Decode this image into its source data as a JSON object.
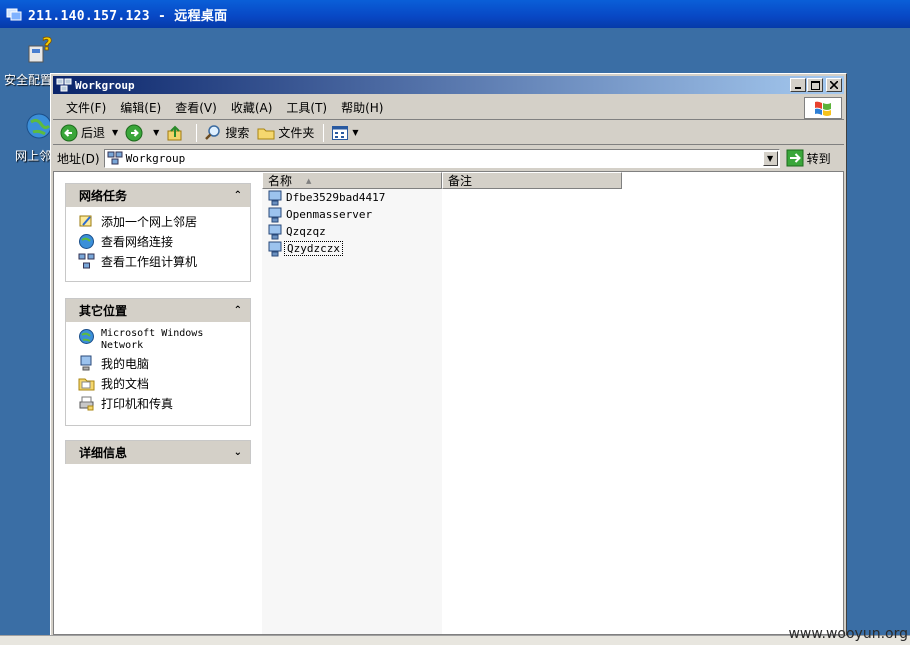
{
  "remote_titlebar": {
    "title": "211.140.157.123 - 远程桌面"
  },
  "desktop": {
    "icons": [
      {
        "label": "安全配置向导",
        "icon": "security-wizard-icon"
      },
      {
        "label": "网上邻居",
        "icon": "network-globe-icon"
      }
    ]
  },
  "window": {
    "title": "Workgroup",
    "menu": [
      "文件(F)",
      "编辑(E)",
      "查看(V)",
      "收藏(A)",
      "工具(T)",
      "帮助(H)"
    ],
    "toolbar": {
      "back": "后退",
      "search": "搜索",
      "folders": "文件夹"
    },
    "address": {
      "label": "地址(D)",
      "value": "Workgroup",
      "go": "转到"
    },
    "taskpane": {
      "network_tasks": {
        "title": "网络任务",
        "items": [
          "添加一个网上邻居",
          "查看网络连接",
          "查看工作组计算机"
        ]
      },
      "other_places": {
        "title": "其它位置",
        "items": [
          "Microsoft Windows Network",
          "我的电脑",
          "我的文档",
          "打印机和传真"
        ]
      },
      "details": {
        "title": "详细信息"
      }
    },
    "list": {
      "columns": [
        "名称",
        "备注"
      ],
      "items": [
        "Dfbe3529bad4417",
        "Openmasserver",
        "Qzqzqz",
        "Qzydzczx"
      ]
    }
  },
  "watermark": "www.wooyun.org",
  "colors": {
    "desktop": "#3a6ea5",
    "titlebar": "#0a246a",
    "panel": "#d4d0c8"
  }
}
